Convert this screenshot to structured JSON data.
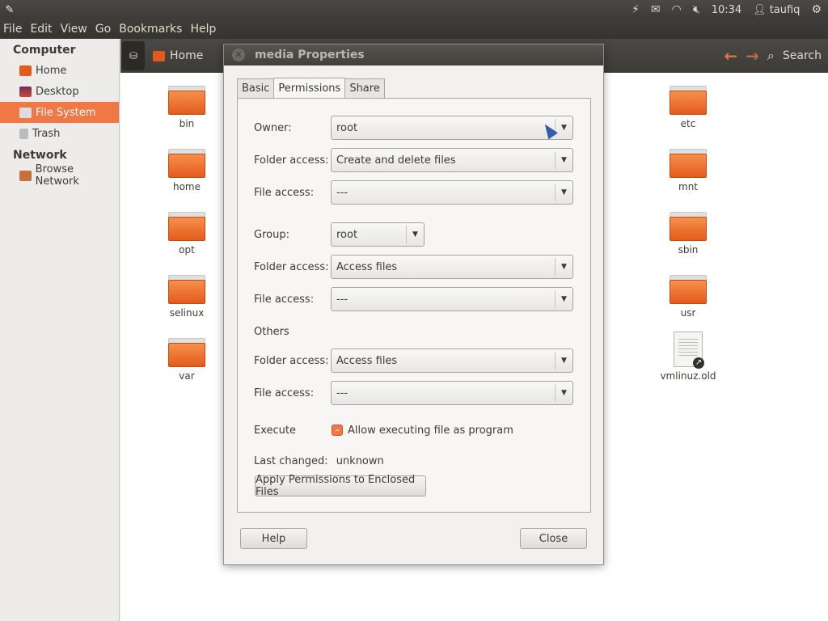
{
  "topbar": {
    "clock": "10:34",
    "user": "taufiq",
    "icons": [
      "pencil-icon",
      "lightning-icon",
      "mail-icon",
      "wifi-icon",
      "volume-muted-icon",
      "user-icon",
      "gear-icon"
    ]
  },
  "menubar": {
    "items": [
      "File",
      "Edit",
      "View",
      "Go",
      "Bookmarks",
      "Help"
    ]
  },
  "sidebar": {
    "sections": [
      {
        "title": "Computer",
        "items": [
          "Home",
          "Desktop",
          "File System",
          "Trash"
        ]
      },
      {
        "title": "Network",
        "items": [
          "Browse Network"
        ]
      }
    ],
    "active": "File System",
    "accent": "#f07746"
  },
  "toolbar": {
    "location": "Home",
    "search": "Search"
  },
  "files": {
    "left": [
      "bin",
      "home",
      "opt",
      "selinux",
      "var"
    ],
    "right": [
      "etc",
      "mnt",
      "sbin",
      "usr",
      "vmlinuz.old"
    ]
  },
  "dialog": {
    "title": "media Properties",
    "tabs": [
      "Basic",
      "Permissions",
      "Share"
    ],
    "active_tab": "Permissions",
    "owner": {
      "label": "Owner:",
      "value": "root"
    },
    "owner_folder": {
      "label": "Folder access:",
      "value": "Create and delete files"
    },
    "owner_file": {
      "label": "File access:",
      "value": "---"
    },
    "group": {
      "label": "Group:",
      "value": "root"
    },
    "group_folder": {
      "label": "Folder access:",
      "value": "Access files"
    },
    "group_file": {
      "label": "File access:",
      "value": "---"
    },
    "others": {
      "label": "Others"
    },
    "others_folder": {
      "label": "Folder access:",
      "value": "Access files"
    },
    "others_file": {
      "label": "File access:",
      "value": "---"
    },
    "execute": {
      "label": "Execute",
      "checkbox_label": "Allow executing file as program"
    },
    "last_changed": {
      "label": "Last changed:",
      "value": "unknown"
    },
    "apply_button": "Apply Permissions to Enclosed Files",
    "help_button": "Help",
    "close_button": "Close"
  }
}
